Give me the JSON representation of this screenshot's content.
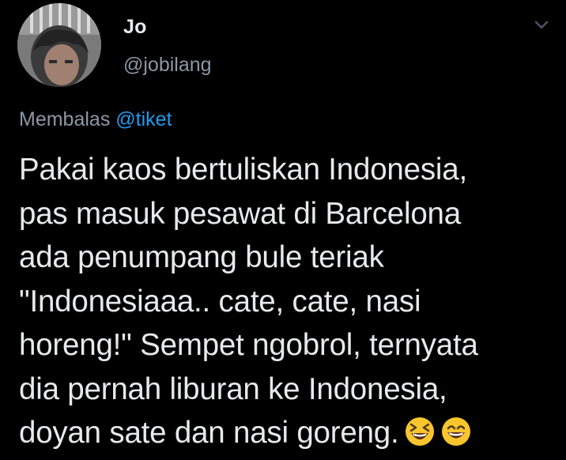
{
  "tweet": {
    "author": {
      "display_name": "Jo",
      "handle": "@jobilang",
      "avatar_icon": "profile-photo"
    },
    "menu_icon": "chevron-down-icon",
    "reply_context": {
      "prefix": "Membalas",
      "mention": "@tiket"
    },
    "text_lines": [
      "Pakai kaos bertuliskan Indonesia,",
      "pas masuk pesawat di Barcelona",
      "ada penumpang bule teriak",
      "\"Indonesiaaa.. cate, cate, nasi",
      "horeng!\" Sempet ngobrol, ternyata",
      "dia pernah liburan ke Indonesia,",
      "doyan sate dan nasi goreng."
    ],
    "emojis": [
      "laughing-squinting-face-icon",
      "grinning-face-icon"
    ]
  },
  "colors": {
    "background": "#000000",
    "text": "#e7e9ea",
    "secondary_text": "#8b98a5",
    "link": "#1d9bf0",
    "emoji_yellow": "#f9c52d"
  }
}
